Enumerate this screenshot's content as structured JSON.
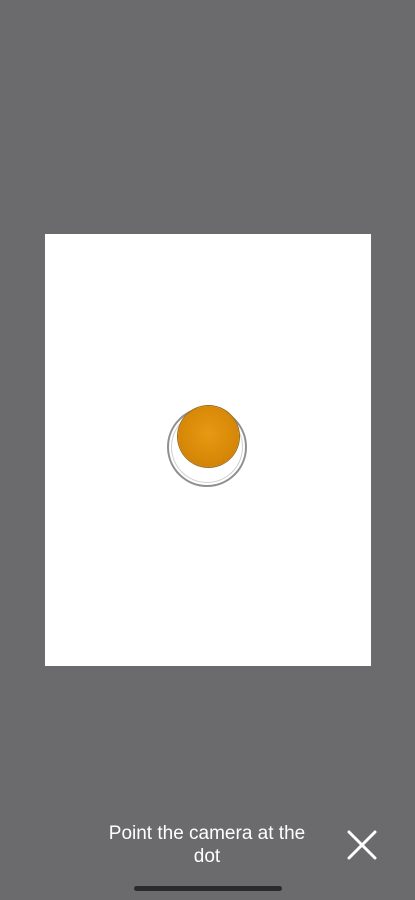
{
  "screen": {
    "background_color": "#6b6a6c"
  },
  "calibration": {
    "card_color": "#ffffff",
    "dot_color": "#d98a08",
    "target_ring_color": "#8f8f8f"
  },
  "footer": {
    "instruction_text": "Point the camera at the dot",
    "close_icon": "close-icon"
  }
}
